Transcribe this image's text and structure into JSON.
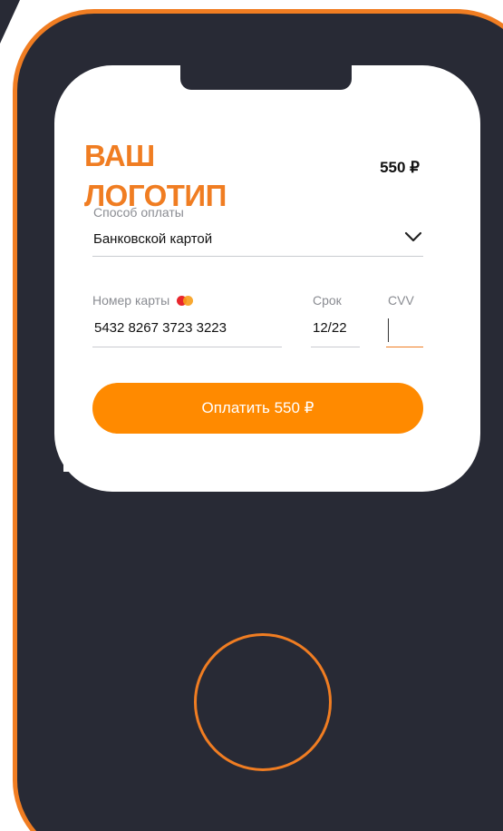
{
  "logo": {
    "text": "ВАШ\nЛОГОТИП"
  },
  "header": {
    "price": "550 ₽"
  },
  "payment_method": {
    "label": "Способ оплаты",
    "selected": "Банковской картой"
  },
  "card": {
    "number_label": "Номер карты",
    "number_value": "5432 8267 3723 3223",
    "expiry_label": "Срок",
    "expiry_value": "12/22",
    "cvv_label": "CVV",
    "cvv_value": ""
  },
  "pay_button": {
    "label": "Оплатить 550 ₽"
  },
  "colors": {
    "accent": "#f07d22",
    "button": "#ff8a00",
    "phone_body": "#282a35",
    "screen": "#ffffff",
    "mastercard_red": "#e8262c",
    "mastercard_orange": "#f79e1b"
  },
  "icons": [
    "chevron-down-icon",
    "mastercard-icon"
  ]
}
